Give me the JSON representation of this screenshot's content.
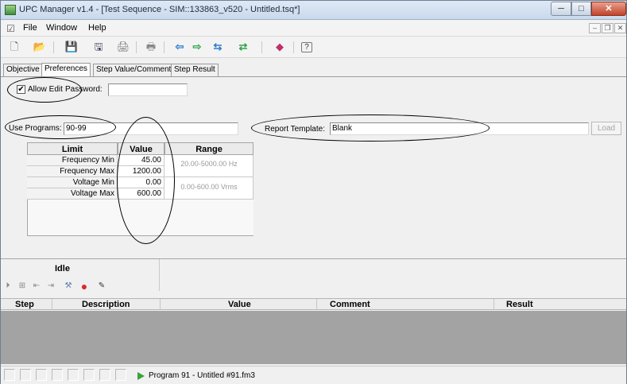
{
  "window": {
    "title": "UPC Manager v1.4 - [Test Sequence - SIM::133863_v520 - Untitled.tsq*]",
    "min_glyph": "─",
    "max_glyph": "□",
    "close_glyph": "✕"
  },
  "menu": {
    "items": [
      "File",
      "Window",
      "Help"
    ],
    "mdi_min": "–",
    "mdi_restore": "❐",
    "mdi_close": "✕"
  },
  "toolbar": {
    "icons": [
      "new-icon",
      "open-folder-icon",
      "save-icon",
      "save-all-icon",
      "print-icon",
      "print-preview-icon",
      "download-icon",
      "upload-icon",
      "transfer-icon",
      "sync-icon",
      "book-icon",
      "help-icon"
    ],
    "glyphs": [
      "🗋",
      "📂",
      "💾",
      "🖫",
      "🖨",
      "🖶",
      "⇦",
      "⇨",
      "⇆",
      "⇄",
      "◆",
      "?"
    ]
  },
  "tabs": [
    {
      "label": "Objective",
      "active": false
    },
    {
      "label": "Preferences",
      "active": true
    },
    {
      "label": "Step Value/Comment",
      "active": false
    },
    {
      "label": "Step Result",
      "active": false
    }
  ],
  "preferences": {
    "allow_edit_label": "Allow Edit",
    "allow_edit_checked": true,
    "check_glyph": "✔",
    "password_label": "Password:",
    "password_value": "",
    "use_programs_label": "Use Programs:",
    "use_programs_value": "90-99",
    "report_template_label": "Report Template:",
    "report_template_value": "Blank",
    "load_label": "Load"
  },
  "limits_table": {
    "headers": [
      "Limit",
      "Value",
      "Range"
    ],
    "rows": [
      {
        "limit": "Frequency Min",
        "value": "45.00"
      },
      {
        "limit": "Frequency Max",
        "value": "1200.00"
      },
      {
        "limit": "Voltage Min",
        "value": "0.00"
      },
      {
        "limit": "Voltage Max",
        "value": "600.00"
      }
    ],
    "ranges": [
      "20.00-5000.00 Hz",
      "0.00-600.00 Vrms"
    ]
  },
  "sequence": {
    "status": "Idle",
    "tool_icons": [
      "step-forward-icon",
      "insert-step-icon",
      "indent-left-icon",
      "indent-right-icon",
      "tools-icon",
      "stop-icon",
      "edit-icon"
    ],
    "tool_glyphs": [
      "⏵",
      "⊞",
      "⇤",
      "⇥",
      "⚒",
      "●",
      "✎"
    ],
    "columns": [
      "Step",
      "Description",
      "Value",
      "Comment",
      "Result"
    ]
  },
  "status_bar": {
    "text": "Program 91 - Untitled #91.fm3"
  },
  "colors": {
    "window_bg": "#f0f0f0",
    "list_body": "#a3a3a3",
    "stop_red": "#d92b2b",
    "play_green": "#3aa33a"
  }
}
